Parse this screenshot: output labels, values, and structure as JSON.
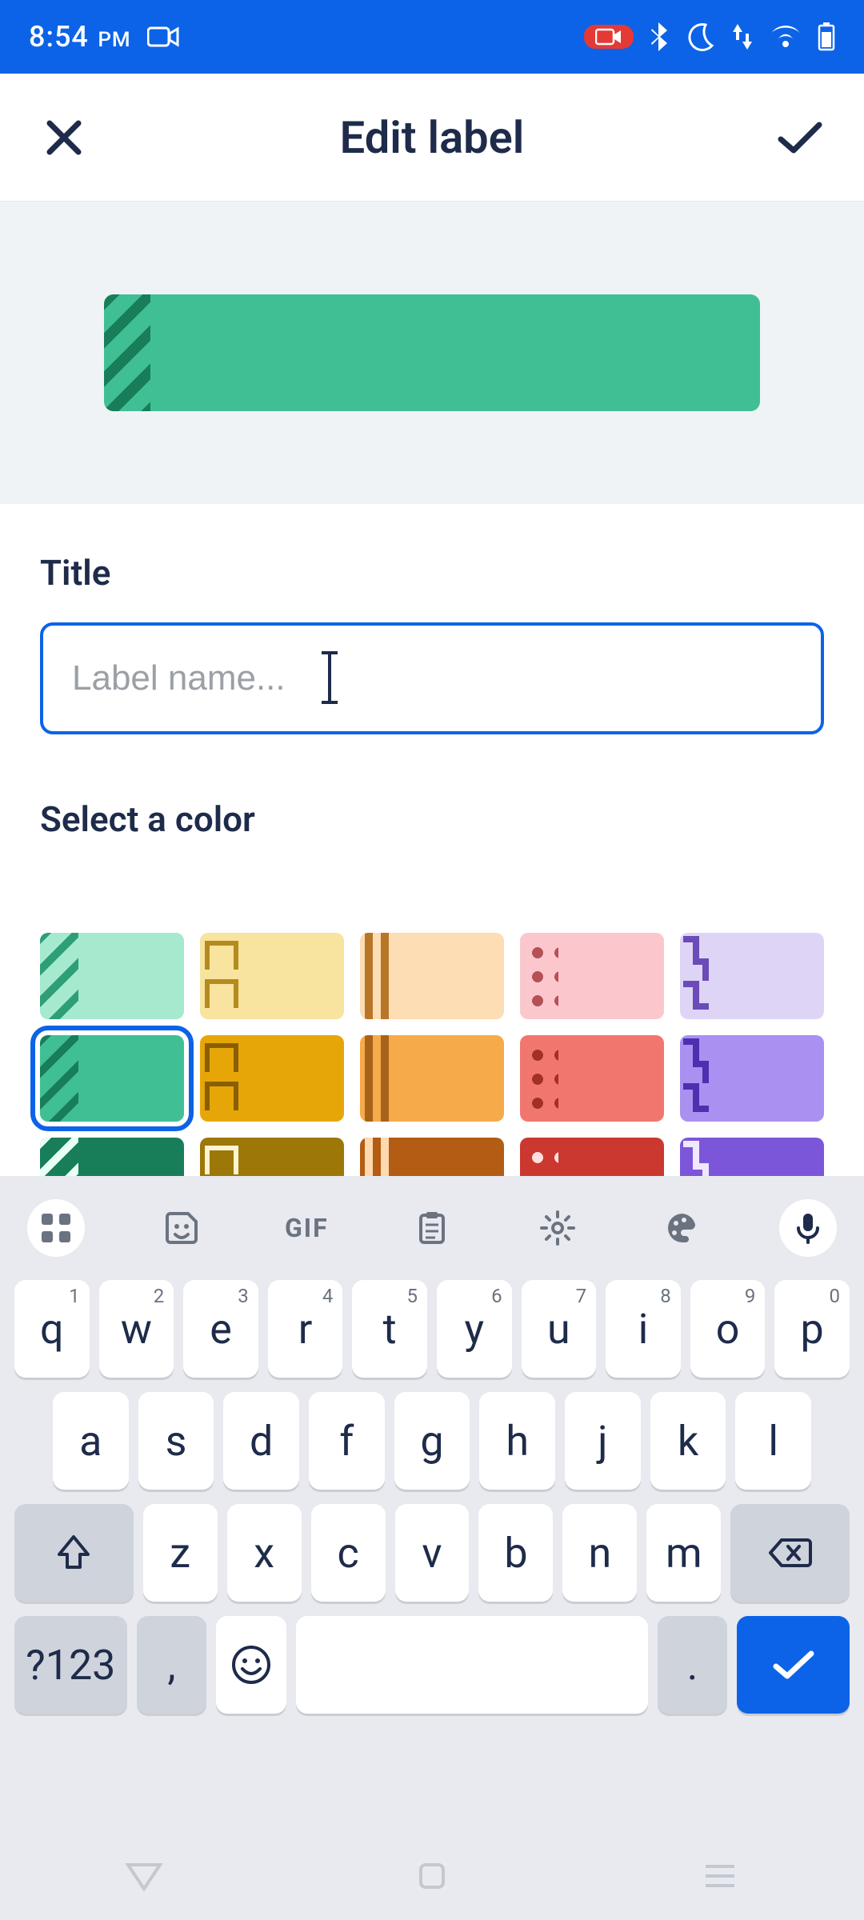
{
  "statusbar": {
    "time": "8:54",
    "time_suffix": "PM",
    "icons_left": [
      "camera"
    ],
    "icons_right": [
      "record",
      "bluetooth",
      "dnd-moon",
      "data-updown",
      "wifi",
      "battery"
    ]
  },
  "appbar": {
    "title": "Edit label",
    "close_icon": "close",
    "confirm_icon": "check"
  },
  "preview": {
    "color": "green",
    "pattern": "stripes"
  },
  "form": {
    "title_label": "Title",
    "title_value": "",
    "title_placeholder": "Label name..."
  },
  "colors": {
    "section_label": "Select a color",
    "selected_index": 5,
    "swatches": [
      {
        "bg": "#a5e9cf",
        "deco": "stripes",
        "dc": "#2e9e77"
      },
      {
        "bg": "#f8e49f",
        "deco": "squares",
        "dc": "#b38b1e"
      },
      {
        "bg": "#fdddb3",
        "deco": "bars",
        "dc": "#b87628"
      },
      {
        "bg": "#fbc7cc",
        "deco": "dots",
        "dc": "#b55055"
      },
      {
        "bg": "#ded5f6",
        "deco": "steps",
        "dc": "#6a4bb8"
      },
      {
        "bg": "#40bf95",
        "deco": "stripes",
        "dc": "#187e59"
      },
      {
        "bg": "#e6a608",
        "deco": "squares",
        "dc": "#8a5f04"
      },
      {
        "bg": "#f7aa4a",
        "deco": "bars",
        "dc": "#a8631a"
      },
      {
        "bg": "#f1776e",
        "deco": "dots",
        "dc": "#a33028"
      },
      {
        "bg": "#aa90f0",
        "deco": "steps",
        "dc": "#4d2fb0"
      },
      {
        "bg": "#187e59",
        "deco": "stripes",
        "dc": "#e8fff5"
      },
      {
        "bg": "#9d7707",
        "deco": "squares",
        "dc": "#fff4d1"
      },
      {
        "bg": "#b35c13",
        "deco": "bars",
        "dc": "#ffd9b0"
      },
      {
        "bg": "#cb3830",
        "deco": "dots",
        "dc": "#ffe0de"
      },
      {
        "bg": "#7c56d9",
        "deco": "steps",
        "dc": "#efe8ff"
      }
    ]
  },
  "keyboard": {
    "toolbar": [
      "apps",
      "sticker",
      "gif",
      "clipboard",
      "settings",
      "palette",
      "mic"
    ],
    "gif_label": "GIF",
    "row1": [
      {
        "k": "q",
        "n": "1"
      },
      {
        "k": "w",
        "n": "2"
      },
      {
        "k": "e",
        "n": "3"
      },
      {
        "k": "r",
        "n": "4"
      },
      {
        "k": "t",
        "n": "5"
      },
      {
        "k": "y",
        "n": "6"
      },
      {
        "k": "u",
        "n": "7"
      },
      {
        "k": "i",
        "n": "8"
      },
      {
        "k": "o",
        "n": "9"
      },
      {
        "k": "p",
        "n": "0"
      }
    ],
    "row2": [
      "a",
      "s",
      "d",
      "f",
      "g",
      "h",
      "j",
      "k",
      "l"
    ],
    "row3": [
      "z",
      "x",
      "c",
      "v",
      "b",
      "n",
      "m"
    ],
    "shift": "shift",
    "backspace": "backspace",
    "sym_label": "?123",
    "comma": ",",
    "emoji": "emoji",
    "period": ".",
    "enter": "enter"
  }
}
